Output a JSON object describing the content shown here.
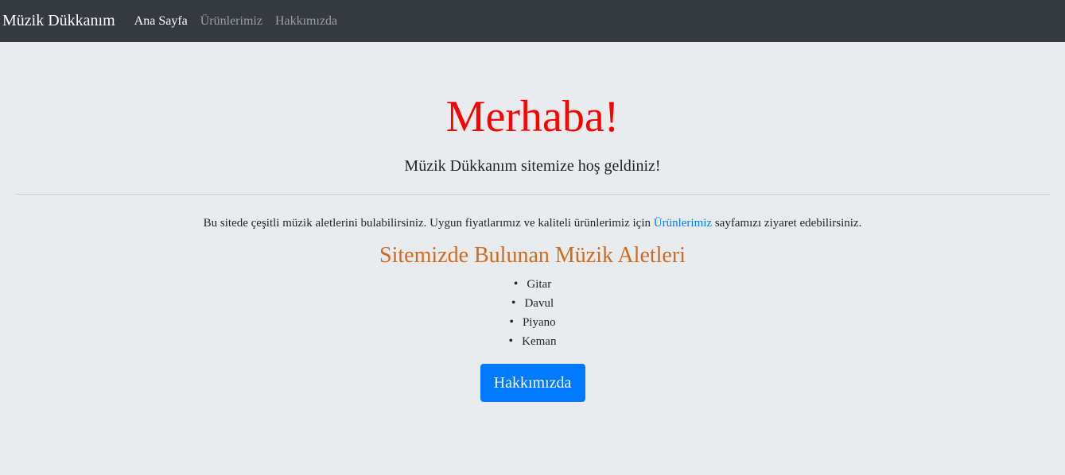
{
  "navbar": {
    "brand": "Müzik Dükkanım",
    "links": [
      {
        "label": "Ana Sayfa",
        "active": true
      },
      {
        "label": "Ürünlerimiz",
        "active": false
      },
      {
        "label": "Hakkımızda",
        "active": false
      }
    ]
  },
  "hero": {
    "title": "Merhaba!",
    "lead": "Müzik Dükkanım sitemize hoş geldiniz!"
  },
  "intro": {
    "before_link": "Bu sitede çeşitli müzik aletlerini bulabilirsiniz. Uygun fiyatlarımız ve kaliteli ürünlerimiz için ",
    "link_text": "Ürünlerimiz",
    "after_link": " sayfamızı ziyaret edebilirsiniz."
  },
  "instruments": {
    "heading": "Sitemizde Bulunan Müzik Aletleri",
    "items": [
      "Gitar",
      "Davul",
      "Piyano",
      "Keman"
    ]
  },
  "cta": {
    "label": "Hakkımızda"
  },
  "colors": {
    "navbar_bg": "#343a40",
    "page_bg": "#e9ecef",
    "hero_title": "#ff0000",
    "section_heading": "#d2691e",
    "primary": "#007bff"
  }
}
